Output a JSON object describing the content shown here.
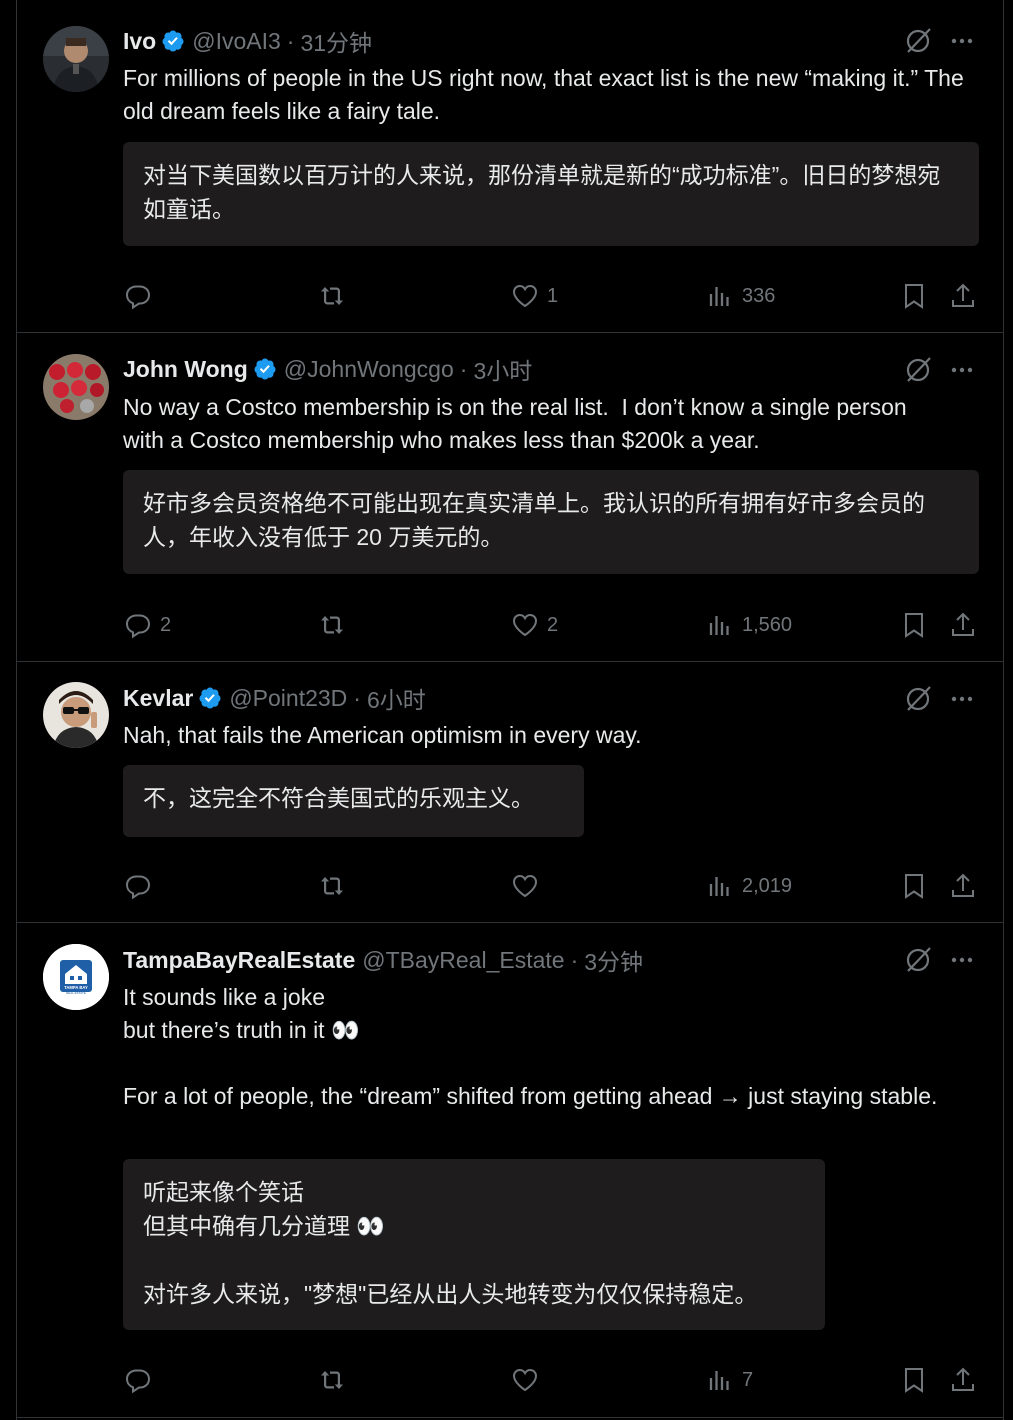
{
  "posts": [
    {
      "name": "Ivo",
      "handle": "@IvoAI3",
      "time": "31分钟",
      "text": "For millions of people in the US right now, that exact list is the new “making it.” The old dream feels like a fairy tale.",
      "translation": "对当下美国数以百万计的人来说，那份清单就是新的“成功标准”。旧日的梦想宛如童话。",
      "replies": "",
      "reposts": "",
      "likes": "1",
      "views": "336",
      "verified": true
    },
    {
      "name": "John Wong",
      "handle": "@JohnWongcgo",
      "time": "3小时",
      "text": "No way a Costco membership is on the real list.  I don’t know a single person with a Costco membership who makes less than $200k a year.",
      "translation": "好市多会员资格绝不可能出现在真实清单上。我认识的所有拥有好市多会员的人，年收入没有低于 20 万美元的。",
      "replies": "2",
      "reposts": "",
      "likes": "2",
      "views": "1,560",
      "verified": true
    },
    {
      "name": "Kevlar",
      "handle": "@Point23D",
      "time": "6小时",
      "text": "Nah, that fails the American optimism in every way.",
      "translation": "不，这完全不符合美国式的乐观主义。",
      "replies": "",
      "reposts": "",
      "likes": "",
      "views": "2,019",
      "verified": true
    },
    {
      "name": "TampaBayRealEstate",
      "handle": "@TBayReal_Estate",
      "time": "3分钟",
      "text": "It sounds like a joke\nbut there’s truth in it 👀\n\nFor a lot of people, the “dream” shifted from getting ahead → just staying stable.",
      "translation": "听起来像个笑话\n但其中确有几分道理 👀\n\n对许多人来说，\"梦想\"已经从出人头地转变为仅仅保持稳定。",
      "replies": "",
      "reposts": "",
      "likes": "",
      "views": "7",
      "verified": false,
      "avatar_text": [
        "TAMPA BAY",
        "REAL ESTATE"
      ]
    }
  ],
  "separator": "·",
  "colors": {
    "verified": "#1d9bf0",
    "muted": "#71767b",
    "border": "#2f3336",
    "translation_bg": "#1e1c1c"
  },
  "icons": [
    "verified-badge-icon",
    "grok-icon",
    "more-icon",
    "reply-icon",
    "repost-icon",
    "like-icon",
    "views-icon",
    "bookmark-icon",
    "share-icon"
  ]
}
